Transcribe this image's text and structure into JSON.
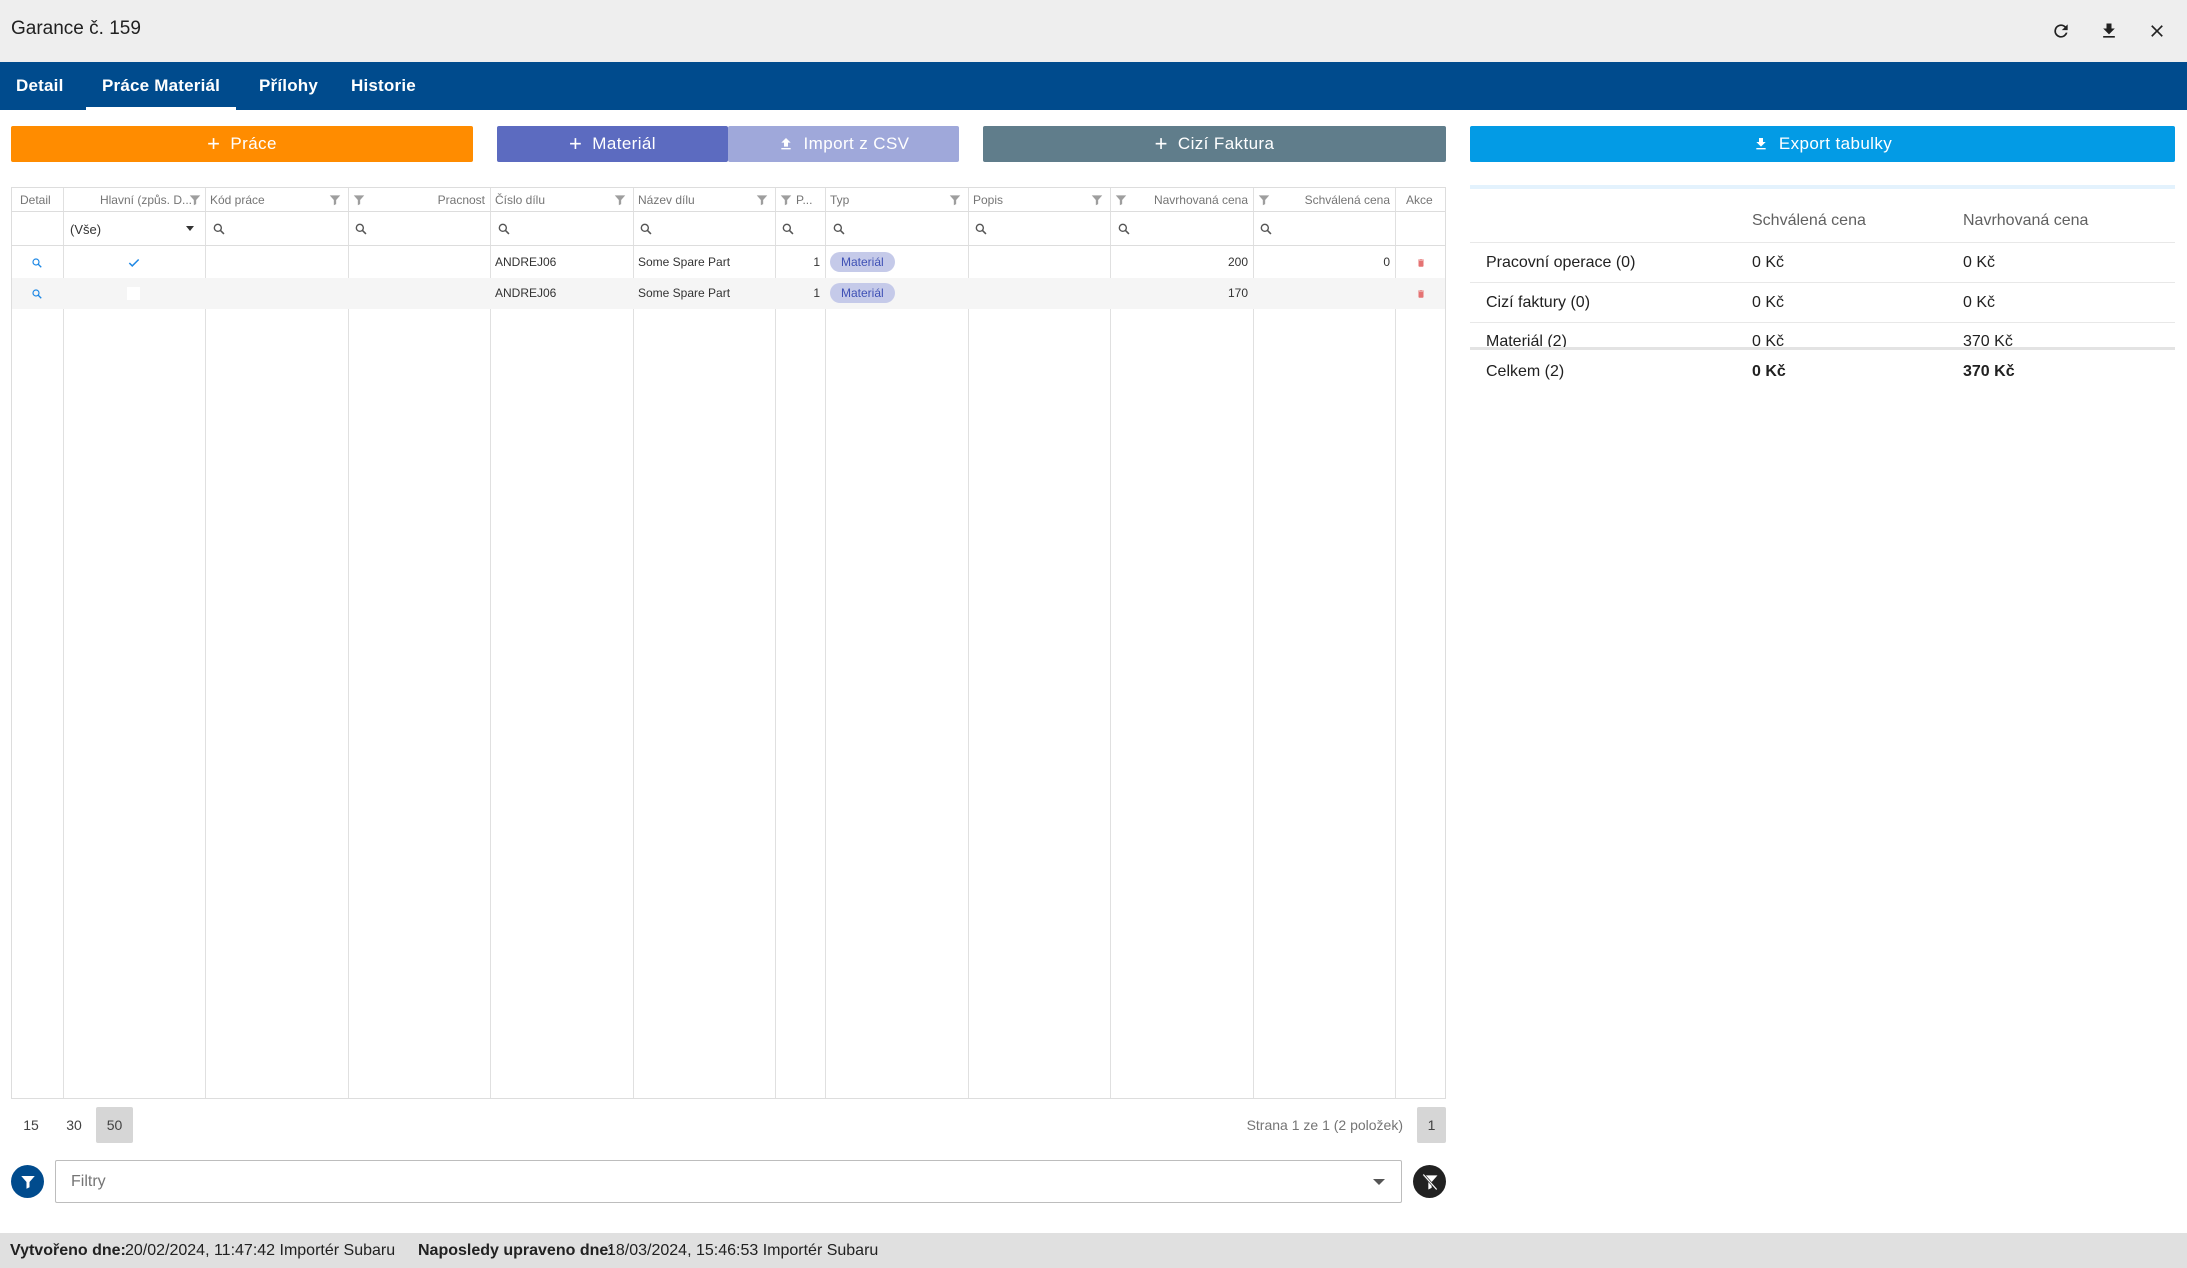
{
  "window": {
    "title": "Garance č. 159",
    "icons": [
      "refresh-icon",
      "download-icon",
      "close-icon"
    ]
  },
  "tabs": [
    {
      "label": "Detail",
      "active": false
    },
    {
      "label": "Práce Materiál",
      "active": true
    },
    {
      "label": "Přílohy",
      "active": false
    },
    {
      "label": "Historie",
      "active": false
    }
  ],
  "toolbar": {
    "prace_label": "Práce",
    "material_label": "Materiál",
    "import_label": "Import z CSV",
    "cizi_faktura_label": "Cizí Faktura",
    "export_label": "Export tabulky",
    "colors": {
      "prace": "#ff8c00",
      "material": "#5c6bc0",
      "import": "#9fa8da",
      "cizi": "#607d8b",
      "export": "#039be5"
    }
  },
  "grid": {
    "columns": [
      "Detail",
      "Hlavní (způs. D...",
      "Kód práce",
      "Pracnost",
      "Číslo dílu",
      "Název dílu",
      "P...",
      "Typ",
      "Popis",
      "Navrhovaná cena",
      "Schválená cena",
      "Akce"
    ],
    "filter_select": "(Vše)",
    "rows": [
      {
        "hlavni": true,
        "cislo": "ANDREJ06",
        "nazev": "Some Spare Part",
        "pocet": "1",
        "typ": "Materiál",
        "navrh": "200",
        "schval": "0"
      },
      {
        "hlavni": false,
        "cislo": "ANDREJ06",
        "nazev": "Some Spare Part",
        "pocet": "1",
        "typ": "Materiál",
        "navrh": "170",
        "schval": ""
      }
    ]
  },
  "pager": {
    "sizes": [
      "15",
      "30",
      "50"
    ],
    "selected_size": "50",
    "info": "Strana 1 ze 1 (2 položek)",
    "page": "1"
  },
  "filters": {
    "placeholder": "Filtry"
  },
  "summary": {
    "headers": [
      "Schválená cena",
      "Navrhovaná cena"
    ],
    "rows": [
      {
        "label": "Pracovní operace (0)",
        "schval": "0 Kč",
        "navrh": "0 Kč"
      },
      {
        "label": "Cizí faktury (0)",
        "schval": "0 Kč",
        "navrh": "0 Kč"
      },
      {
        "label": "Materiál (2)",
        "schval": "0 Kč",
        "navrh": "370 Kč"
      }
    ],
    "total": {
      "label": "Celkem (2)",
      "schval": "0 Kč",
      "navrh": "370 Kč"
    }
  },
  "footer": {
    "created_label": "Vytvořeno dne:",
    "created_value": "20/02/2024, 11:47:42 Importér Subaru",
    "modified_label": "Naposledy upraveno dne:",
    "modified_value": "18/03/2024, 15:46:53 Importér Subaru"
  }
}
